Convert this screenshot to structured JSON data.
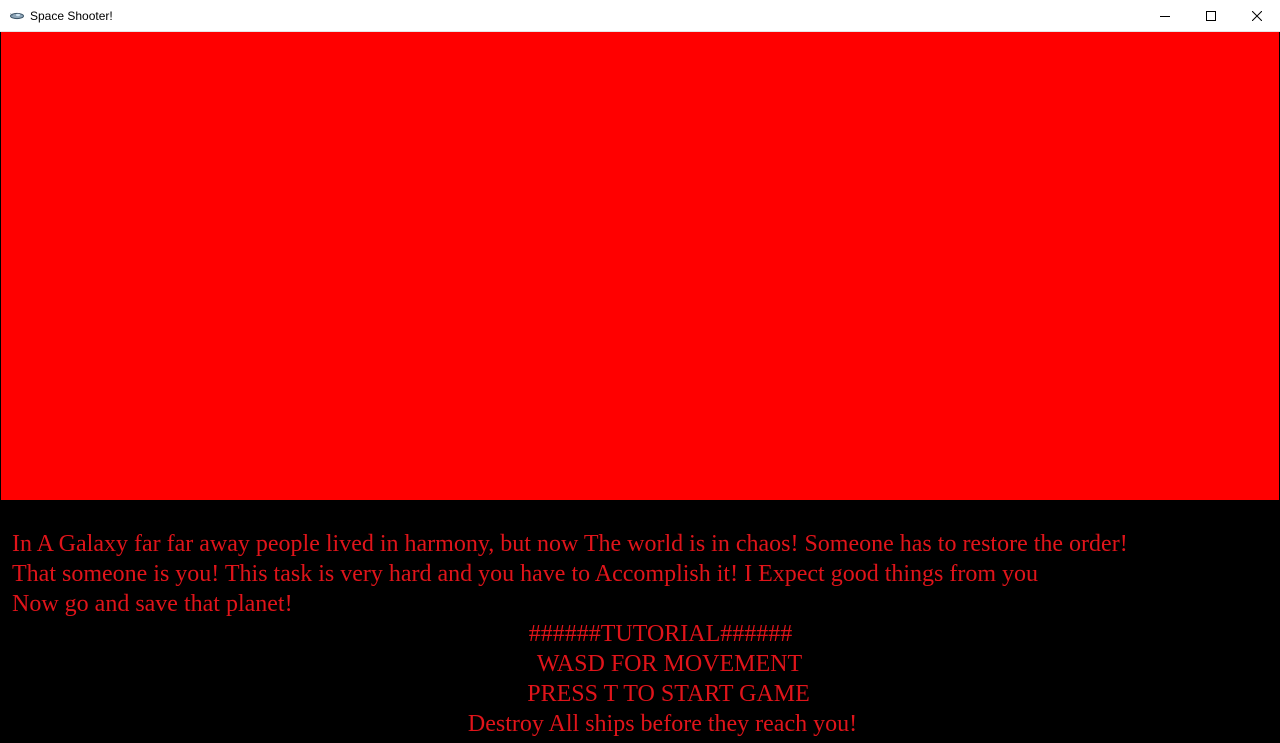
{
  "window": {
    "title": "Space Shooter!",
    "app_icon": "spaceship-icon",
    "controls": {
      "minimize_icon": "minimize-icon",
      "maximize_icon": "maximize-icon",
      "close_icon": "close-icon"
    }
  },
  "game": {
    "colors": {
      "panel": "#ff0000",
      "background": "#000000",
      "text": "#e0141a"
    },
    "story": {
      "line1": "In A Galaxy far far away people lived in harmony, but now The world is in chaos! Someone has to restore the order!",
      "line2": "That someone is you! This task is very hard and you have to Accomplish it! I Expect good things from you",
      "line3": "Now go and save that planet!"
    },
    "tutorial": {
      "heading": "######TUTORIAL######",
      "movement": "WASD FOR MOVEMENT",
      "start": "PRESS T TO START GAME",
      "goal": "Destroy All ships before they reach you!"
    }
  }
}
